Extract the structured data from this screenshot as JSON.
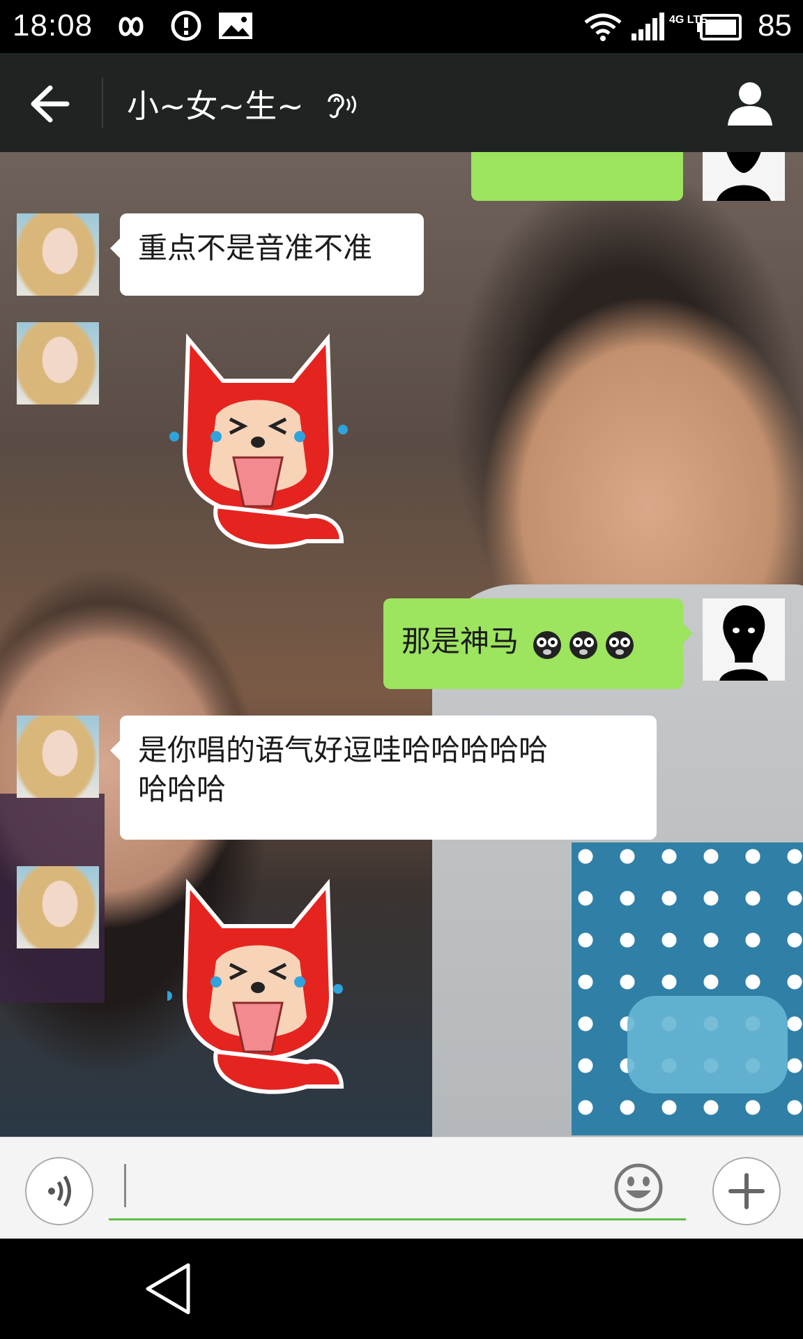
{
  "status_bar": {
    "time": "18:08",
    "network": "4G LTE",
    "battery": "85"
  },
  "header": {
    "title": "小~女~生~"
  },
  "messages": [
    {
      "side": "left",
      "type": "text",
      "text": "重点不是音准不准"
    },
    {
      "side": "left",
      "type": "sticker",
      "sticker": "crying-laughing-fox-sticker"
    },
    {
      "side": "right",
      "type": "text",
      "text": "那是神马",
      "emoji": [
        "shocked-emoji",
        "shocked-emoji",
        "shocked-emoji"
      ]
    },
    {
      "side": "left",
      "type": "text",
      "text_line1": "是你唱的语气好逗哇哈哈哈哈哈",
      "text_line2": "哈哈哈"
    },
    {
      "side": "left",
      "type": "sticker",
      "sticker": "crying-laughing-fox-sticker"
    }
  ],
  "colors": {
    "header_bg": "#1f2322",
    "outgoing_bubble": "#9de45f",
    "incoming_bubble": "#ffffff",
    "input_underline": "#62bb46"
  },
  "input": {
    "value": ""
  }
}
